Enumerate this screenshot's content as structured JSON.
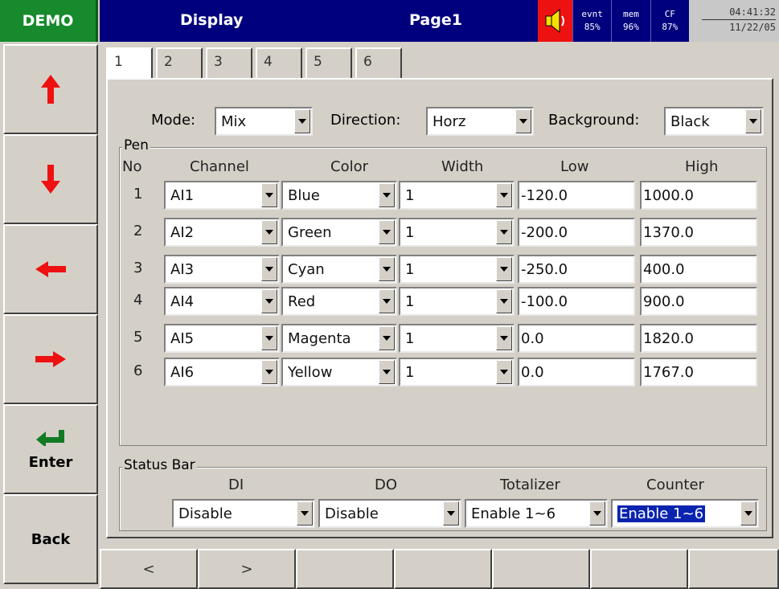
{
  "header": {
    "logo": "DEMO",
    "title": "Display",
    "page": "Page1",
    "stats": [
      {
        "label": "evnt",
        "value": "85%"
      },
      {
        "label": "mem",
        "value": "96%"
      },
      {
        "label": "CF",
        "value": "87%"
      }
    ],
    "time": "04:41:32",
    "date": "11/22/05"
  },
  "leftnav": {
    "enter_label": "Enter",
    "back_label": "Back"
  },
  "tabs": [
    "1",
    "2",
    "3",
    "4",
    "5",
    "6"
  ],
  "settings": {
    "mode_label": "Mode:",
    "mode_value": "Mix",
    "direction_label": "Direction:",
    "direction_value": "Horz",
    "background_label": "Background:",
    "background_value": "Black"
  },
  "pen": {
    "group_title": "Pen",
    "headers": {
      "no": "No",
      "channel": "Channel",
      "color": "Color",
      "width": "Width",
      "low": "Low",
      "high": "High"
    },
    "rows": [
      {
        "no": "1",
        "channel": "AI1",
        "color": "Blue",
        "width": "1",
        "low": "-120.0",
        "high": "1000.0"
      },
      {
        "no": "2",
        "channel": "AI2",
        "color": "Green",
        "width": "1",
        "low": "-200.0",
        "high": "1370.0"
      },
      {
        "no": "3",
        "channel": "AI3",
        "color": "Cyan",
        "width": "1",
        "low": "-250.0",
        "high": "400.0"
      },
      {
        "no": "4",
        "channel": "AI4",
        "color": "Red",
        "width": "1",
        "low": "-100.0",
        "high": "900.0"
      },
      {
        "no": "5",
        "channel": "AI5",
        "color": "Magenta",
        "width": "1",
        "low": "0.0",
        "high": "1820.0"
      },
      {
        "no": "6",
        "channel": "AI6",
        "color": "Yellow",
        "width": "1",
        "low": "0.0",
        "high": "1767.0"
      }
    ]
  },
  "status_bar": {
    "group_title": "Status Bar",
    "di_label": "DI",
    "di_value": "Disable",
    "do_label": "DO",
    "do_value": "Disable",
    "totalizer_label": "Totalizer",
    "totalizer_value": "Enable 1~6",
    "counter_label": "Counter",
    "counter_value": "Enable 1~6"
  },
  "bottombar": {
    "prev_label": "<",
    "next_label": ">"
  },
  "colors": {
    "title_bg": "#00007e",
    "logo_bg": "#168a2c",
    "arrow_red": "#ee1111",
    "enter_green": "#117a22",
    "selection": "#0a24b0"
  }
}
